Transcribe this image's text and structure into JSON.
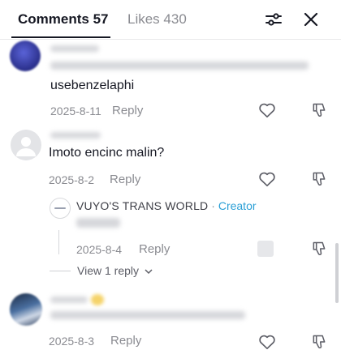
{
  "tabs": {
    "comments_label": "Comments 57",
    "likes_label": "Likes 430"
  },
  "icons": {
    "filter": "sliders-icon",
    "close": "close-icon",
    "like": "heart-outline-icon",
    "dislike": "thumbs-down-icon"
  },
  "comments": [
    {
      "text": "usebenzelaphi",
      "date": "2025-8-11",
      "reply_label": "Reply"
    },
    {
      "text": "Imoto encinc malin?",
      "date": "2025-8-2",
      "reply_label": "Reply",
      "creator_reply": {
        "author": "VUYO'S TRANS WORLD",
        "separator": " · ",
        "badge": "Creator",
        "date": "2025-8-4",
        "reply_label": "Reply"
      },
      "view_replies": "View 1 reply"
    },
    {
      "date": "2025-8-3",
      "reply_label": "Reply"
    }
  ],
  "colors": {
    "text_primary": "#161823",
    "text_secondary": "#8a8b91",
    "creator_accent": "#2a9fd6"
  }
}
